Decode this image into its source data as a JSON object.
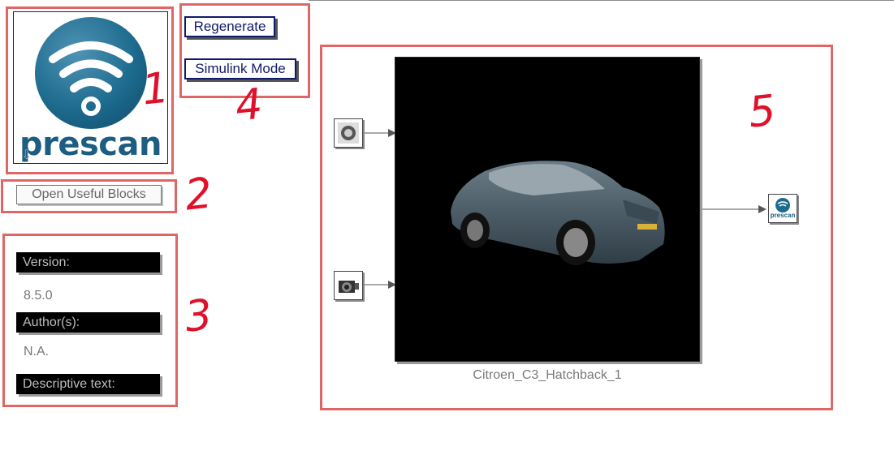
{
  "logo": {
    "wordmark": "prescan"
  },
  "buttons": {
    "regenerate": "Regenerate",
    "simulink_mode": "Simulink Mode",
    "open_useful_blocks": "Open Useful Blocks"
  },
  "info": {
    "version_label": "Version:",
    "version_value": "8.5.0",
    "authors_label": "Author(s):",
    "authors_value": "N.A.",
    "descriptive_label": "Descriptive text:"
  },
  "block": {
    "name": "Citroen_C3_Hatchback_1",
    "output_icon_text": "prescan"
  },
  "annotations": {
    "logo": "1",
    "open_blocks": "2",
    "info": "3",
    "buttons": "4",
    "block": "5"
  },
  "colors": {
    "annotation": "#e06666",
    "button_text": "#101a6a",
    "logo_blue": "#1d6b8e"
  },
  "icons": [
    "wifi-icon",
    "sensor-input-icon",
    "camera-input-icon",
    "prescan-output-icon"
  ]
}
